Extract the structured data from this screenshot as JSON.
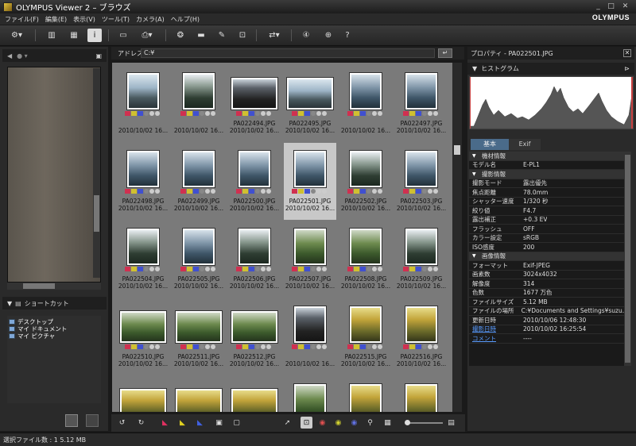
{
  "window": {
    "title": "OLYMPUS Viewer 2 – ブラウズ",
    "brand": "OLYMPUS",
    "min": "_",
    "max": "□",
    "close": "✕"
  },
  "menu": [
    "ファイル(F)",
    "編集(E)",
    "表示(V)",
    "ツール(T)",
    "カメラ(A)",
    "ヘルプ(H)"
  ],
  "address": {
    "label": "アドレス:",
    "value": "C:¥"
  },
  "shortcuts": {
    "title": "ショートカット",
    "items": [
      "デスクトップ",
      "マイ ドキュメント",
      "マイ ピクチャ"
    ]
  },
  "thumbnails": [
    {
      "name": "",
      "date": "2010/10/02 16...",
      "tone": "city"
    },
    {
      "name": "",
      "date": "2010/10/02 16...",
      "tone": "tree"
    },
    {
      "name": "PA022494.JPG",
      "date": "2010/10/02 16...",
      "tone": "dark"
    },
    {
      "name": "PA022495.JPG",
      "date": "2010/10/02 16...",
      "tone": "city"
    },
    {
      "name": "",
      "date": "2010/10/02 16...",
      "tone": "canal"
    },
    {
      "name": "PA022497.JPG",
      "date": "2010/10/02 16...",
      "tone": "canal"
    },
    {
      "name": "PA022498.JPG",
      "date": "2010/10/02 16...",
      "tone": "canal"
    },
    {
      "name": "PA022499.JPG",
      "date": "2010/10/02 16...",
      "tone": "canal"
    },
    {
      "name": "PA022500.JPG",
      "date": "2010/10/02 16...",
      "tone": "canal"
    },
    {
      "name": "PA022501.JPG",
      "date": "2010/10/02 16...",
      "tone": "canal"
    },
    {
      "name": "PA022502.JPG",
      "date": "2010/10/02 16...",
      "tone": "tree"
    },
    {
      "name": "PA022503.JPG",
      "date": "2010/10/02 16...",
      "tone": "canal"
    },
    {
      "name": "PA022504.JPG",
      "date": "2010/10/02 16...",
      "tone": "tree"
    },
    {
      "name": "PA022505.JPG",
      "date": "2010/10/02 16...",
      "tone": "canal"
    },
    {
      "name": "PA022506.JPG",
      "date": "2010/10/02 16...",
      "tone": "tree"
    },
    {
      "name": "PA022507.JPG",
      "date": "2010/10/02 16...",
      "tone": "green"
    },
    {
      "name": "PA022508.JPG",
      "date": "2010/10/02 16...",
      "tone": "green"
    },
    {
      "name": "PA022509.JPG",
      "date": "2010/10/02 16...",
      "tone": "tree"
    },
    {
      "name": "PA022510.JPG",
      "date": "2010/10/02 16...",
      "tone": "green"
    },
    {
      "name": "PA022511.JPG",
      "date": "2010/10/02 16...",
      "tone": "green"
    },
    {
      "name": "PA022512.JPG",
      "date": "2010/10/02 16...",
      "tone": "green"
    },
    {
      "name": "",
      "date": "2010/10/02 16...",
      "tone": "dark"
    },
    {
      "name": "PA022515.JPG",
      "date": "2010/10/02 16...",
      "tone": "yellow"
    },
    {
      "name": "PA022516.JPG",
      "date": "2010/10/02 16...",
      "tone": "yellow"
    },
    {
      "name": "",
      "date": "",
      "tone": "yellow"
    },
    {
      "name": "",
      "date": "",
      "tone": "yellow"
    },
    {
      "name": "",
      "date": "",
      "tone": "yellow"
    },
    {
      "name": "",
      "date": "",
      "tone": "green"
    },
    {
      "name": "",
      "date": "",
      "tone": "yellow"
    },
    {
      "name": "",
      "date": "",
      "tone": "yellow"
    }
  ],
  "selected_index": 9,
  "right_panel": {
    "title": "プロパティ - PA022501.JPG",
    "histogram_label": "ヒストグラム",
    "tabs": [
      "基本",
      "Exif"
    ],
    "groups": [
      {
        "title": "機材情報",
        "rows": [
          [
            "モデル名",
            "E-PL1"
          ]
        ]
      },
      {
        "title": "撮影情報",
        "rows": [
          [
            "撮影モード",
            "露出優先"
          ],
          [
            "焦点距離",
            "78.0mm"
          ],
          [
            "シャッター速度",
            "1/320 秒"
          ],
          [
            "絞り値",
            "F4.7"
          ],
          [
            "露出補正",
            "+0.3 EV"
          ],
          [
            "フラッシュ",
            "OFF"
          ],
          [
            "カラー設定",
            "sRGB"
          ],
          [
            "ISO感度",
            "200"
          ]
        ]
      },
      {
        "title": "画像情報",
        "rows": [
          [
            "フォーマット",
            "Exif-JPEG"
          ],
          [
            "画素数",
            "3024x4032"
          ],
          [
            "解像度",
            "314"
          ],
          [
            "色数",
            "1677 万色"
          ],
          [
            "ファイルサイズ",
            "5.12 MB"
          ],
          [
            "ファイルの場所",
            "C:¥Documents and Settings¥suzu..."
          ],
          [
            "更新日時",
            "2010/10/06 12:48:30"
          ]
        ]
      }
    ],
    "links": [
      [
        "撮影日時",
        "2010/10/02 16:25:54"
      ],
      [
        "コメント",
        "----"
      ]
    ]
  },
  "status": {
    "text": "選択ファイル数 : 1  5.12 MB"
  },
  "colors": {
    "accent": "#5a9cff",
    "selection": "#c8c8c8",
    "histogram_red": "#c84040"
  }
}
